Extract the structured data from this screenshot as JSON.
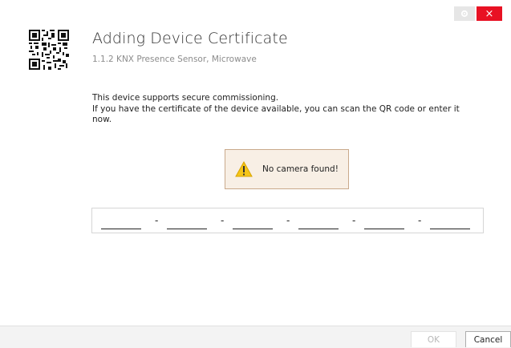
{
  "window": {
    "settings_icon": "gear-icon",
    "close_label": "×",
    "close_color": "#e81123"
  },
  "header": {
    "qr_icon": "qr-code-icon",
    "title": "Adding Device Certificate",
    "subtitle": "1.1.2 KNX Presence Sensor, Microwave"
  },
  "body": {
    "description_line1": "This device supports secure commissioning.",
    "description_line2": "If you have the certificate of the device available, you can scan the QR code or enter it now."
  },
  "camera_warning": {
    "icon": "warning-icon",
    "text": "No camera found!"
  },
  "certificate_input": {
    "separator": "-",
    "segment_count": 6
  },
  "footer": {
    "ok_label": "OK",
    "cancel_label": "Cancel"
  }
}
